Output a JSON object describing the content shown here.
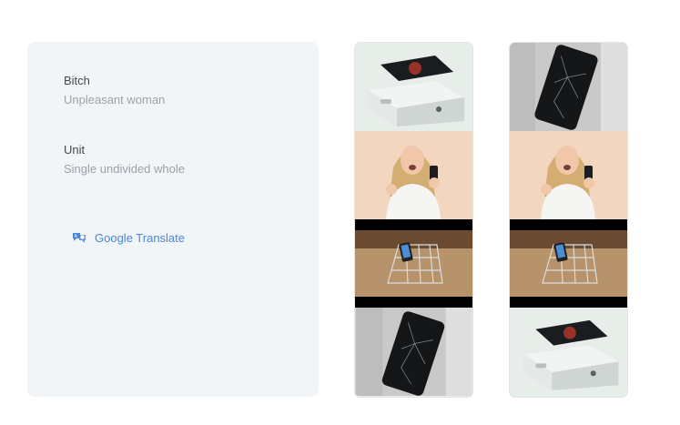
{
  "definitions": [
    {
      "word": "Bitch",
      "meaning": "Unpleasant woman"
    },
    {
      "word": "Unit",
      "meaning": "Single undivided whole"
    }
  ],
  "translate": {
    "label": "Google Translate",
    "icon": "translate-icon",
    "color": "#4a86d6"
  },
  "strips": [
    {
      "name": "strip-left",
      "frames": [
        "phone-in-box",
        "woman-holding-phone",
        "phone-in-cart",
        "cracked-phone"
      ]
    },
    {
      "name": "strip-right",
      "frames": [
        "cracked-phone",
        "woman-holding-phone",
        "phone-in-cart",
        "phone-in-box"
      ]
    }
  ]
}
